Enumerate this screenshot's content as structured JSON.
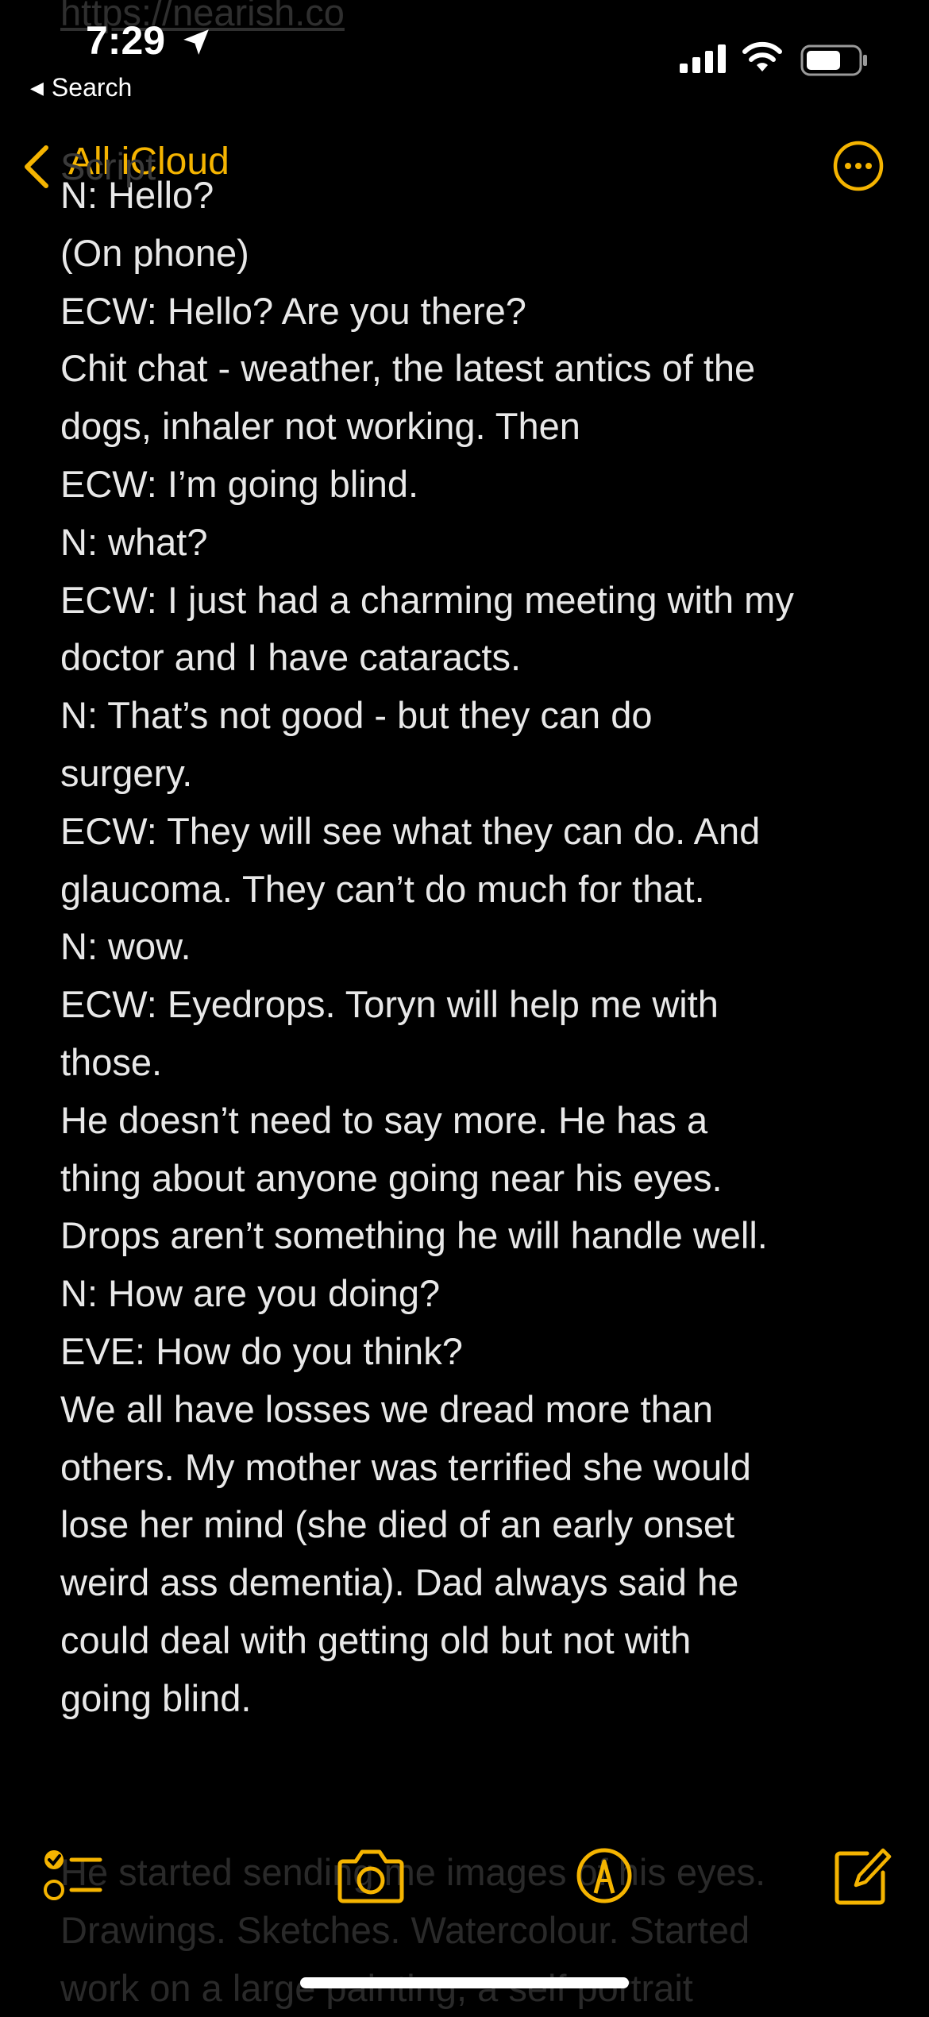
{
  "status_bar": {
    "time": "7:29",
    "back_app": "Search"
  },
  "nav": {
    "back_label": "All iCloud",
    "accent_color": "#f5b400"
  },
  "note": {
    "ghost_header": "Script",
    "lines": [
      "N: Hello?",
      "(On phone)",
      "ECW: Hello? Are you there?",
      "Chit chat - weather, the latest antics of the",
      "dogs, inhaler not working. Then",
      "ECW: I’m going blind.",
      "N: what?",
      "ECW: I just had a charming meeting with my",
      "doctor and I have cataracts.",
      "N: That’s not good - but they can do",
      "surgery.",
      "ECW: They will see what they can do. And",
      "glaucoma. They can’t do much for that.",
      "N: wow.",
      "ECW: Eyedrops. Toryn will help me with",
      "those.",
      "He doesn’t need to say more. He has a",
      "thing about anyone going near his eyes.",
      "Drops aren’t something he will handle well.",
      "N: How are you doing?",
      "EVE: How do you think?",
      "We all have losses we dread more than",
      "others. My mother was terrified she would",
      "lose her mind (she died of an early onset",
      "weird ass dementia). Dad always said he",
      "could deal with getting old but not with",
      "going blind."
    ],
    "under_toolbar_lines": [
      "He started sending me images of his eyes.",
      "Drawings. Sketches. Watercolour. Started",
      "work on a large painting, a self portrait"
    ]
  },
  "toolbar": {
    "icons": [
      "checklist-icon",
      "camera-icon",
      "markup-icon",
      "compose-icon"
    ]
  }
}
